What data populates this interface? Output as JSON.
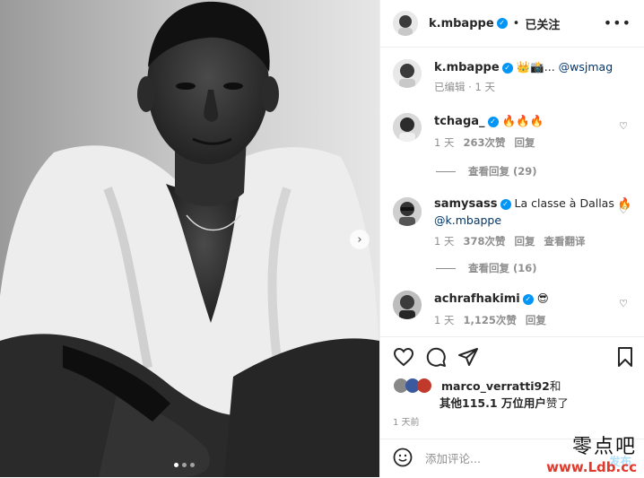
{
  "post": {
    "username": "k.mbappe",
    "follow_status": "已关注",
    "image_alt": "Black and white portrait of a man in an open white shirt",
    "carousel": {
      "total": 3,
      "active": 1
    }
  },
  "caption": {
    "username": "k.mbappe",
    "text": "👑📸... ",
    "mention": "@wsjmag",
    "edited": "已编辑",
    "time": "1 天"
  },
  "comments": [
    {
      "username": "tchaga_",
      "text": "🔥🔥🔥",
      "time": "1 天",
      "likes": "263次赞",
      "reply": "回复",
      "view_replies": "查看回复 (29)"
    },
    {
      "username": "samysass",
      "text": "La classe à Dallas 🔥",
      "mention": "@k.mbappe",
      "time": "1 天",
      "likes": "378次赞",
      "reply": "回复",
      "translate": "查看翻译",
      "view_replies": "查看回复 (16)"
    },
    {
      "username": "achrafhakimi",
      "text": "😎",
      "time": "1 天",
      "likes": "1,125次赞",
      "reply": "回复"
    }
  ],
  "likes": {
    "first_user": "marco_verratti92",
    "suffix": "和",
    "others": "其他115.1 万位用户",
    "tail": "赞了"
  },
  "timestamp": "1 天前",
  "add_comment": {
    "placeholder": "添加评论...",
    "post_label": "发布"
  },
  "watermark": {
    "cn": "零点吧",
    "url": "www.Ldb.cc"
  },
  "colors": {
    "verified": "#0095f6",
    "link": "#00376b",
    "muted": "#8e8e8e",
    "watermark_red": "#e0392b"
  }
}
